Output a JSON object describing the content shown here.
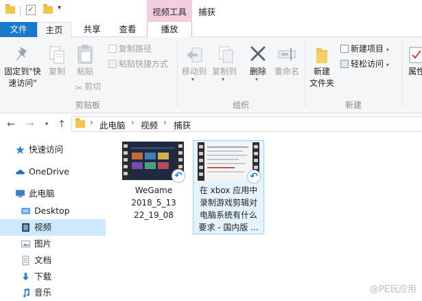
{
  "window": {
    "contextual_tab_group": "视频工具",
    "title": "捕获"
  },
  "ribbon_tabs": {
    "file": "文件",
    "home": "主页",
    "share": "共享",
    "view": "查看",
    "play": "播放"
  },
  "ribbon": {
    "clipboard": {
      "pin_line1": "固定到\"快",
      "pin_line2": "速访问\"",
      "copy": "复制",
      "paste": "粘贴",
      "copy_path": "复制路径",
      "paste_shortcut": "粘贴快捷方式",
      "cut": "剪切",
      "group_label": "剪贴板"
    },
    "organize": {
      "move_to": "移动到",
      "copy_to": "复制到",
      "delete": "删除",
      "rename": "重命名",
      "group_label": "组织"
    },
    "new": {
      "new_folder_line1": "新建",
      "new_folder_line2": "文件夹",
      "new_item": "新建项目",
      "easy_access": "轻松访问",
      "group_label": "新建"
    },
    "open": {
      "properties": "属性"
    }
  },
  "address_bar": {
    "breadcrumbs": [
      "此电脑",
      "视频",
      "捕获"
    ]
  },
  "sidebar": {
    "items": [
      {
        "label": "快速访问",
        "icon": "star-icon"
      },
      {
        "label": "OneDrive",
        "icon": "cloud-icon"
      },
      {
        "label": "此电脑",
        "icon": "computer-icon"
      },
      {
        "label": "Desktop",
        "icon": "desktop-folder-icon"
      },
      {
        "label": "视频",
        "icon": "video-folder-icon",
        "selected": true
      },
      {
        "label": "图片",
        "icon": "pictures-folder-icon"
      },
      {
        "label": "文档",
        "icon": "documents-folder-icon"
      },
      {
        "label": "下载",
        "icon": "download-icon"
      },
      {
        "label": "音乐",
        "icon": "music-icon"
      }
    ]
  },
  "files": [
    {
      "lines": [
        "WeGame",
        "2018_5_13",
        "22_19_08"
      ],
      "icon": "video-file-icon"
    },
    {
      "lines": [
        "在 xbox 应用中",
        "录制游戏剪辑对",
        "电脑系统有什么",
        "要求 - 国内版 ..."
      ],
      "icon": "video-file-icon",
      "selected": true
    }
  ],
  "watermark": "@PE玩应用",
  "colors": {
    "file_tab": "#1979ca",
    "contextual_tab": "#f5cde0",
    "selection": "#cde8ff",
    "accent_blue": "#1c7ed6"
  }
}
